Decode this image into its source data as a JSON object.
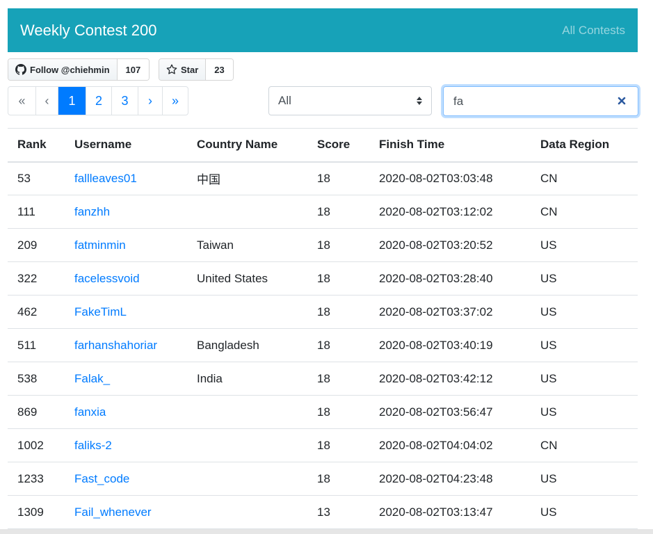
{
  "navbar": {
    "title": "Weekly Contest 200",
    "link": "All Contests"
  },
  "github": {
    "follow_label": "Follow @chiehmin",
    "follow_count": "107",
    "star_label": "Star",
    "star_count": "23"
  },
  "pagination": {
    "first": "«",
    "prev": "‹",
    "pages": [
      "1",
      "2",
      "3"
    ],
    "next": "›",
    "last": "»",
    "active_page": "1"
  },
  "region_filter": {
    "selected": "All"
  },
  "search": {
    "value": "fa"
  },
  "table": {
    "headers": [
      "Rank",
      "Username",
      "Country Name",
      "Score",
      "Finish Time",
      "Data Region"
    ],
    "rows": [
      [
        "53",
        "fallleaves01",
        "中国",
        "18",
        "2020-08-02T03:03:48",
        "CN"
      ],
      [
        "111",
        "fanzhh",
        "",
        "18",
        "2020-08-02T03:12:02",
        "CN"
      ],
      [
        "209",
        "fatminmin",
        "Taiwan",
        "18",
        "2020-08-02T03:20:52",
        "US"
      ],
      [
        "322",
        "facelessvoid",
        "United States",
        "18",
        "2020-08-02T03:28:40",
        "US"
      ],
      [
        "462",
        "FakeTimL",
        "",
        "18",
        "2020-08-02T03:37:02",
        "US"
      ],
      [
        "511",
        "farhanshahoriar",
        "Bangladesh",
        "18",
        "2020-08-02T03:40:19",
        "US"
      ],
      [
        "538",
        "Falak_",
        "India",
        "18",
        "2020-08-02T03:42:12",
        "US"
      ],
      [
        "869",
        "fanxia",
        "",
        "18",
        "2020-08-02T03:56:47",
        "US"
      ],
      [
        "1002",
        "faliks-2",
        "",
        "18",
        "2020-08-02T04:04:02",
        "CN"
      ],
      [
        "1233",
        "Fast_code",
        "",
        "18",
        "2020-08-02T04:23:48",
        "US"
      ],
      [
        "1309",
        "Fail_whenever",
        "",
        "13",
        "2020-08-02T03:13:47",
        "US"
      ]
    ]
  },
  "colors": {
    "navbar": "#17a2b8",
    "link": "#007bff",
    "active_page": "#007bff"
  },
  "icons": {
    "follow": "github-icon",
    "star": "star-icon",
    "clear": "close-icon",
    "select": "sort-arrows-icon"
  }
}
